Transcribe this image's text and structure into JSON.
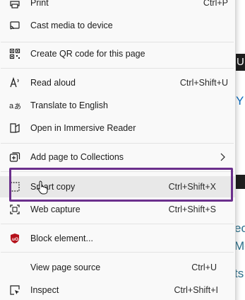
{
  "menu": {
    "items": [
      {
        "name": "print",
        "label": "Print",
        "shortcut": "Ctrl+P",
        "icon": "printer-icon"
      },
      {
        "name": "cast-media",
        "label": "Cast media to device",
        "shortcut": "",
        "icon": "cast-icon"
      },
      {
        "name": "create-qr",
        "label": "Create QR code for this page",
        "shortcut": "",
        "icon": "qr-code-icon"
      },
      {
        "name": "read-aloud",
        "label": "Read aloud",
        "shortcut": "Ctrl+Shift+U",
        "icon": "read-aloud-icon"
      },
      {
        "name": "translate",
        "label": "Translate to English",
        "shortcut": "",
        "icon": "translate-icon"
      },
      {
        "name": "immersive-reader",
        "label": "Open in Immersive Reader",
        "shortcut": "",
        "icon": "immersive-reader-icon"
      },
      {
        "name": "add-to-collections",
        "label": "Add page to Collections",
        "shortcut": "",
        "icon": "collections-icon"
      },
      {
        "name": "smart-copy",
        "label": "Smart copy",
        "shortcut": "Ctrl+Shift+X",
        "icon": "smart-copy-icon"
      },
      {
        "name": "web-capture",
        "label": "Web capture",
        "shortcut": "Ctrl+Shift+S",
        "icon": "web-capture-icon"
      },
      {
        "name": "block-element",
        "label": "Block element...",
        "shortcut": "",
        "icon": "ublock-icon"
      },
      {
        "name": "view-source",
        "label": "View page source",
        "shortcut": "Ctrl+U",
        "icon": ""
      },
      {
        "name": "inspect",
        "label": "Inspect",
        "shortcut": "Ctrl+Shift+I",
        "icon": "inspect-icon"
      }
    ]
  },
  "background": {
    "dark_bar_text": "U",
    "link_1": "Y",
    "link_2": "eo",
    "link_3": "Mc",
    "link_4": "ts"
  },
  "colors": {
    "highlight": "#6b2f8c",
    "menu_bg": "#f9f9f9",
    "hover_bg": "#e8e8e8",
    "ublock_red": "#b5121b"
  }
}
